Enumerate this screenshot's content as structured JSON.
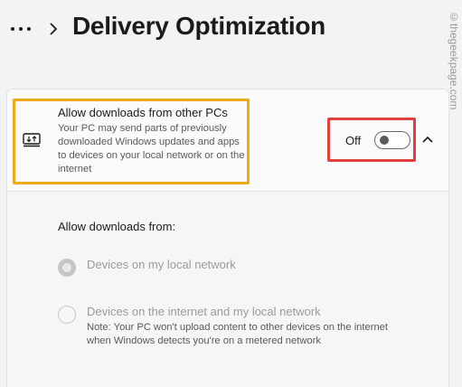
{
  "page": {
    "title": "Delivery Optimization",
    "watermark": "©thegeekpage.com"
  },
  "nav": {
    "more_icon": "ellipsis-icon",
    "separator_icon": "chevron-right-icon"
  },
  "setting": {
    "icon": "download-device-icon",
    "title": "Allow downloads from other PCs",
    "description": "Your PC may send parts of previously downloaded Windows updates and apps to devices on your local network or on the internet",
    "toggle_state_label": "Off",
    "toggle_on": false,
    "expand_icon": "chevron-up-icon"
  },
  "downloads_from": {
    "label": "Allow downloads from:",
    "options": [
      {
        "label": "Devices on my local network",
        "selected": true
      },
      {
        "label": "Devices on the internet and my local network",
        "selected": false,
        "note": "Note: Your PC won't upload content to other devices on the internet when Windows detects you're on a metered network"
      }
    ]
  },
  "colors": {
    "highlight_orange": "#f0a81c",
    "highlight_red": "#e04040",
    "background": "#f3f3f3",
    "card": "#fbfbfb"
  }
}
